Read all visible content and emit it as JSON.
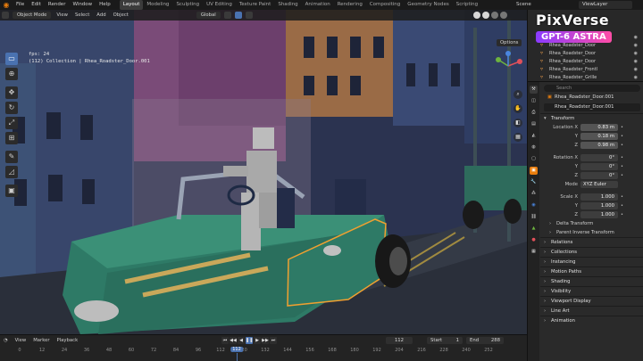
{
  "menubar": {
    "menus": [
      "File",
      "Edit",
      "Render",
      "Window",
      "Help"
    ],
    "workspaces": [
      "Layout",
      "Modeling",
      "Sculpting",
      "UV Editing",
      "Texture Paint",
      "Shading",
      "Animation",
      "Rendering",
      "Compositing",
      "Geometry Nodes",
      "Scripting"
    ],
    "active_workspace": "Layout",
    "scene_label": "Scene",
    "view_layer": "ViewLayer"
  },
  "viewport": {
    "mode": "Object Mode",
    "menus": [
      "View",
      "Select",
      "Add",
      "Object"
    ],
    "transform_orientation": "Global",
    "options_label": "Options",
    "stats": {
      "fps": "fps: 24",
      "info": "(112) Collection | Rhea_Roadster_Door.001"
    }
  },
  "outliner": {
    "items": [
      {
        "name": "Rhea_Roadster_Dash"
      },
      {
        "name": "Rhea_Roadster_Door"
      },
      {
        "name": "Rhea_Roadster_Door"
      },
      {
        "name": "Rhea_Roadster_Door"
      },
      {
        "name": "Rhea_Roadster_Frontl"
      },
      {
        "name": "Rhea_Roadster_Grille"
      },
      {
        "name": "Rhea_Roadster_Headl"
      }
    ]
  },
  "properties": {
    "search_placeholder": "Search",
    "breadcrumb": "Rhea_Roadster_Door.001",
    "object_name": "Rhea_Roadster_Door.001",
    "transform_label": "Transform",
    "location": {
      "label": "Location X",
      "x": "0.83 m",
      "y": "0.18 m",
      "z": "0.98 m"
    },
    "rotation": {
      "label": "Rotation X",
      "x": "0°",
      "y": "0°",
      "z": "0°"
    },
    "mode": {
      "label": "Mode",
      "value": "XYZ Euler"
    },
    "scale": {
      "label": "Scale X",
      "x": "1.000",
      "y": "1.000",
      "z": "1.000"
    },
    "axis_y": "Y",
    "axis_z": "Z",
    "subpanels": [
      "Delta Transform",
      "Parent Inverse Transform"
    ],
    "panels": [
      "Relations",
      "Collections",
      "Instancing",
      "Motion Paths",
      "Shading",
      "Visibility",
      "Viewport Display",
      "Line Art",
      "Animation"
    ]
  },
  "timeline": {
    "menus": [
      "View",
      "Marker",
      "Playback"
    ],
    "current_frame": "112",
    "start_label": "Start",
    "start": "1",
    "end_label": "End",
    "end": "288",
    "ticks": [
      "0",
      "12",
      "24",
      "36",
      "48",
      "60",
      "72",
      "84",
      "96",
      "112",
      "120",
      "132",
      "144",
      "156",
      "168",
      "180",
      "192",
      "204",
      "216",
      "228",
      "240",
      "252"
    ],
    "cursor_label": "112"
  },
  "watermark": {
    "brand": "PixVerse",
    "model": "GPT-6 ASTRA"
  },
  "colors": {
    "accent": "#4a72b0",
    "selection": "#f0a030",
    "car_body": "#2e7a66"
  }
}
